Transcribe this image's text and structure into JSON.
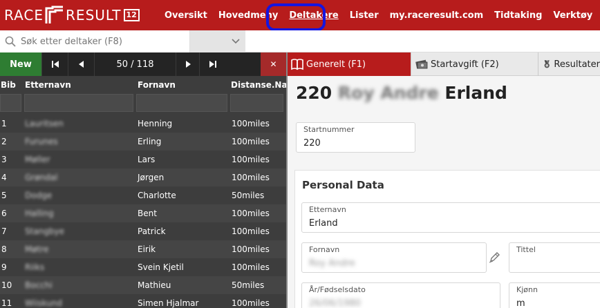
{
  "app": {
    "logo_left": "RACE",
    "logo_right": "RESULT",
    "logo_version": "12"
  },
  "nav": [
    {
      "label": "Oversikt"
    },
    {
      "label": "Hovedmeny"
    },
    {
      "label": "Deltakere"
    },
    {
      "label": "Lister"
    },
    {
      "label": "my.raceresult.com"
    },
    {
      "label": "Tidtaking"
    },
    {
      "label": "Verktøy"
    }
  ],
  "search": {
    "placeholder": "Søk etter deltaker (F8)"
  },
  "toolbar": {
    "new_label": "New",
    "pager": "50 / 118",
    "clear_label": "✕"
  },
  "table": {
    "columns": [
      "Bib",
      "Etternavn",
      "Fornavn",
      "Distanse.Na"
    ],
    "rows": [
      {
        "bib": "1",
        "last": "Lauritsen",
        "first": "Henning",
        "dist": "100miles"
      },
      {
        "bib": "2",
        "last": "Furunes",
        "first": "Erling",
        "dist": "100miles"
      },
      {
        "bib": "3",
        "last": "Møller",
        "first": "Lars",
        "dist": "100miles"
      },
      {
        "bib": "4",
        "last": "Grøndal",
        "first": "Jørgen",
        "dist": "100miles"
      },
      {
        "bib": "5",
        "last": "Dodge",
        "first": "Charlotte",
        "dist": "50miles"
      },
      {
        "bib": "6",
        "last": "Halling",
        "first": "Bent",
        "dist": "100miles"
      },
      {
        "bib": "7",
        "last": "Stangbye",
        "first": "Patrick",
        "dist": "100miles"
      },
      {
        "bib": "8",
        "last": "Møtre",
        "first": "Eirik",
        "dist": "100miles"
      },
      {
        "bib": "9",
        "last": "Riiks",
        "first": "Svein Kjetil",
        "dist": "100miles"
      },
      {
        "bib": "10",
        "last": "Bocchi",
        "first": "Mathieu",
        "dist": "50miles"
      },
      {
        "bib": "11",
        "last": "Wiiskund",
        "first": "Simen Hjalmar",
        "dist": "100miles"
      }
    ]
  },
  "tabs": [
    {
      "label": "Generelt (F1)"
    },
    {
      "label": "Startavgift (F2)"
    },
    {
      "label": "Resultater"
    }
  ],
  "detail": {
    "bib": "220",
    "first_name_blurred": "Roy Andre",
    "last_name": "Erland",
    "startnummer_label": "Startnummer",
    "startnummer_value": "220",
    "section_title": "Personal Data",
    "etternavn_label": "Etternavn",
    "etternavn_value": "Erland",
    "fornavn_label": "Fornavn",
    "fornavn_value": "Roy Andre",
    "tittel_label": "Tittel",
    "dob_label": "År/Fødselsdato",
    "dob_value": "26/06/1980",
    "kjonn_label": "Kjønn",
    "kjonn_value": "m"
  },
  "colors": {
    "brand_red": "#b71c1c",
    "new_green": "#2e7d32",
    "highlight_blue": "#1515e0"
  }
}
